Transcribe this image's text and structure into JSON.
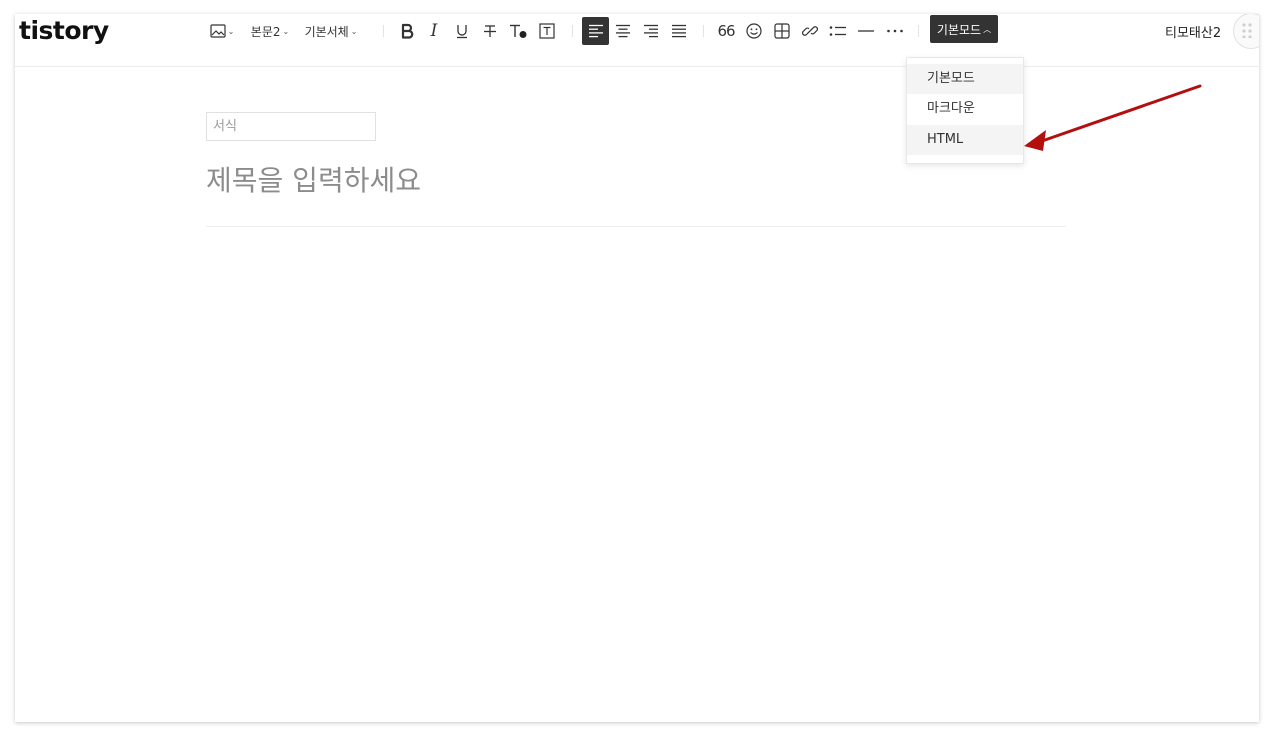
{
  "brand": {
    "logo": "tistory"
  },
  "toolbar": {
    "paragraph_style": "본문2",
    "font_style": "기본서체",
    "italic_label": "I",
    "quote_label": "66",
    "mode_label": "기본모드"
  },
  "mode_menu": {
    "items": [
      {
        "label": "기본모드"
      },
      {
        "label": "마크다운"
      },
      {
        "label": "HTML"
      }
    ]
  },
  "editor": {
    "category_placeholder": "서식",
    "title_placeholder": "제목을 입력하세요"
  },
  "user": {
    "name": "티모태산2"
  },
  "colors": {
    "accent_dark": "#333333",
    "annotation_arrow": "#b30f0f",
    "dropdown_highlight": "#f4f4f4"
  }
}
